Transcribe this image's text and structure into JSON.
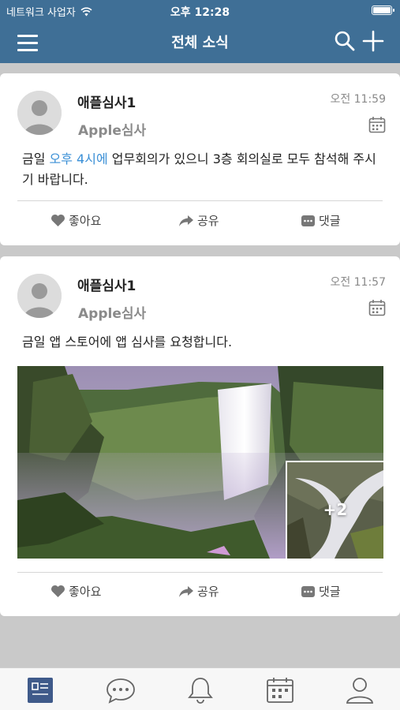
{
  "status_bar": {
    "carrier": "네트워크 사업자",
    "time": "오후 12:28",
    "wifi_icon": "wifi-icon",
    "battery_icon": "battery-icon"
  },
  "navbar": {
    "title": "전체 소식",
    "background_color": "#3f6f96",
    "left_icon": "menu-icon",
    "right_icons": [
      "search-icon",
      "plus-icon"
    ]
  },
  "posts": [
    {
      "author": "애플심사1",
      "department": "Apple심사",
      "time": "오전 11:59",
      "text_before": "금일 ",
      "text_highlight": "오후 4시에",
      "text_after": " 업무회의가 있으니 3층 회의실로 모두 참석해 주시기 바랍니다.",
      "highlight_color": "#3a8fd6",
      "actions": {
        "like": "좋아요",
        "share": "공유",
        "comment": "댓글"
      }
    },
    {
      "author": "애플심사1",
      "department": "Apple심사",
      "time": "오전 11:57",
      "text": "금일 앱 스토어에 앱 심사를 요청합니다.",
      "extra_photos": "+2",
      "actions": {
        "like": "좋아요",
        "share": "공유",
        "comment": "댓글"
      }
    }
  ],
  "tabbar": {
    "tabs": [
      "feed-icon",
      "chat-icon",
      "bell-icon",
      "calendar-icon",
      "profile-icon"
    ],
    "active_color": "#3f5a8a"
  }
}
